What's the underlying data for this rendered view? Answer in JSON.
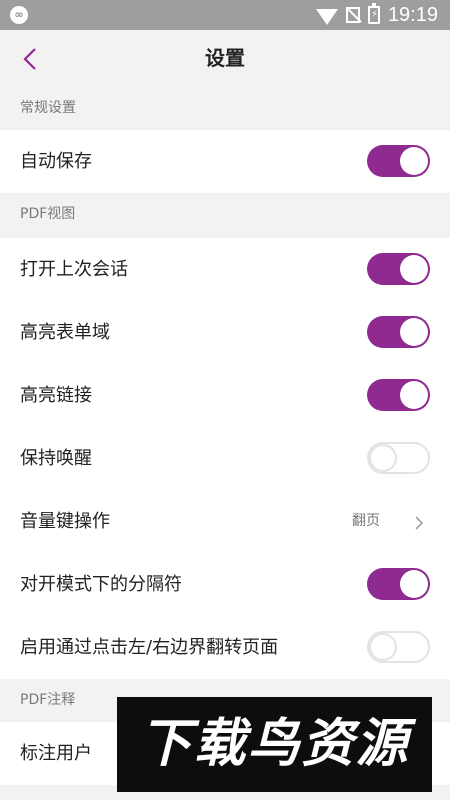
{
  "status_bar": {
    "app_icon": "infinity-icon",
    "time": "19:19",
    "icons": [
      "wifi-icon",
      "no-signal-icon",
      "battery-charging-icon"
    ]
  },
  "header": {
    "back_icon": "chevron-left-icon",
    "title": "设置"
  },
  "sections": {
    "general": {
      "title": "常规设置",
      "autosave": {
        "label": "自动保存",
        "on": true
      }
    },
    "pdf_view": {
      "title": "PDF视图",
      "open_last_session": {
        "label": "打开上次会话",
        "on": true
      },
      "highlight_form_fields": {
        "label": "高亮表单域",
        "on": true
      },
      "highlight_links": {
        "label": "高亮链接",
        "on": true
      },
      "keep_awake": {
        "label": "保持唤醒",
        "on": false
      },
      "volume_key_action": {
        "label": "音量键操作",
        "value": "翻页"
      },
      "spread_mode_separator": {
        "label": "对开模式下的分隔符",
        "on": true
      },
      "tap_edge_turn_page": {
        "label": "启用通过点击左/右边界翻转页面",
        "on": false
      }
    },
    "pdf_annotation": {
      "title": "PDF注释",
      "annotation_user": {
        "label": "标注用户"
      }
    }
  },
  "watermark": {
    "text": "下载鸟资源"
  },
  "colors": {
    "accent": "#8f2a91",
    "status_bar": "#9e9e9e",
    "background": "#f2f2f2"
  }
}
